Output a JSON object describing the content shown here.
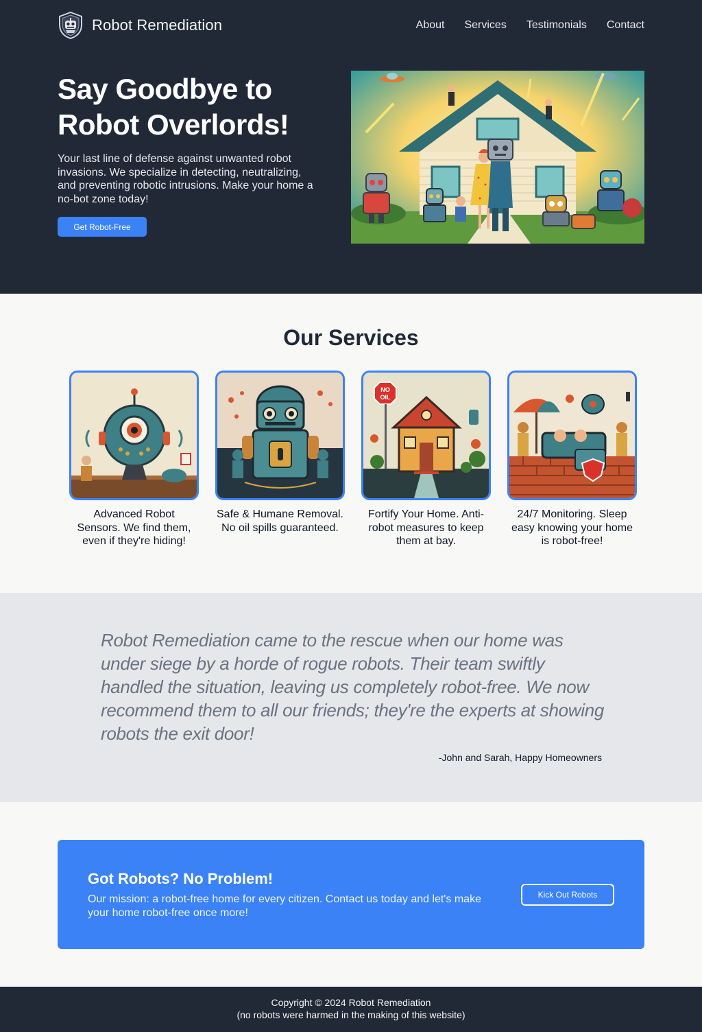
{
  "header": {
    "brand": "Robot Remediation",
    "logo_icon": "shield-robot-icon",
    "nav": [
      {
        "label": "About"
      },
      {
        "label": "Services"
      },
      {
        "label": "Testimonials"
      },
      {
        "label": "Contact"
      }
    ]
  },
  "hero": {
    "title_line1": "Say Goodbye to",
    "title_line2": "Robot Overlords!",
    "text": "Your last line of defense against unwanted robot invasions. We specialize in detecting, neutralizing, and preventing robotic intrusions. Make your home a no-bot zone today!",
    "button": "Get Robot-Free",
    "image_alt": "retro-house-robots-illustration"
  },
  "services": {
    "title": "Our Services",
    "items": [
      {
        "text": "Advanced Robot Sensors. We find them, even if they're hiding!",
        "image": "sensor-robot-illustration"
      },
      {
        "text": "Safe & Humane Removal. No oil spills guaranteed.",
        "image": "removal-robot-illustration"
      },
      {
        "text": "Fortify Your Home. Anti-robot measures to keep them at bay.",
        "image": "fortified-house-illustration",
        "sign_line1": "NO",
        "sign_line2": "OIL"
      },
      {
        "text": "24/7 Monitoring. Sleep easy knowing your home is robot-free!",
        "image": "monitoring-guards-illustration"
      }
    ]
  },
  "testimonial": {
    "quote": "Robot Remediation came to the rescue when our home was under siege by a horde of rogue robots. Their team swiftly handled the situation, leaving us completely robot-free. We now recommend them to all our friends; they're the experts at showing robots the exit door!",
    "author": "-John and Sarah, Happy Homeowners"
  },
  "cta": {
    "title": "Got Robots? No Problem!",
    "text": "Our mission: a robot-free home for every citizen. Contact us today and let's make your home robot-free once more!",
    "button": "Kick Out Robots"
  },
  "footer": {
    "copyright": "Copyright © 2024 Robot Remediation",
    "note": "(no robots were harmed in the making of this website)"
  },
  "colors": {
    "dark": "#222936",
    "accent": "#3b82f6",
    "light_bg": "#f8f8f7",
    "testimonial_bg": "#e5e7eb"
  }
}
